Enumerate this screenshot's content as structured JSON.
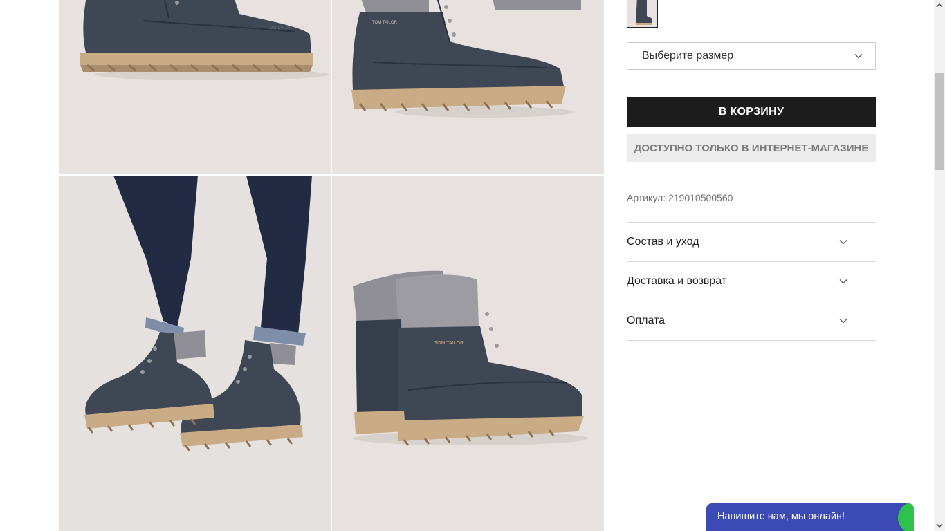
{
  "product": {
    "size_select": {
      "placeholder": "Выберите размер"
    },
    "add_to_cart_label": "В КОРЗИНУ",
    "online_only_label": "ДОСТУПНО ТОЛЬКО В ИНТЕРНЕТ-МАГАЗИНЕ",
    "sku": "Артикул: 219010500560",
    "brand_on_shoe": "TOM TAILOR",
    "colors": {
      "boot": "#3f4654",
      "sole": "#c9ab85",
      "knit": "#8f8f95",
      "jeans": "#222a44",
      "photo_bg": "#e7e2df",
      "cart_button": "#1c1c1c",
      "chat_bg": "#3c4ab5",
      "chat_status": "#2fc24a"
    }
  },
  "accordion": [
    {
      "label": "Состав и уход",
      "icon": "chevron-down-icon"
    },
    {
      "label": "Доставка и возврат",
      "icon": "chevron-down-icon"
    },
    {
      "label": "Оплата",
      "icon": "chevron-down-icon"
    }
  ],
  "chat": {
    "label": "Напишите нам, мы онлайн!"
  }
}
